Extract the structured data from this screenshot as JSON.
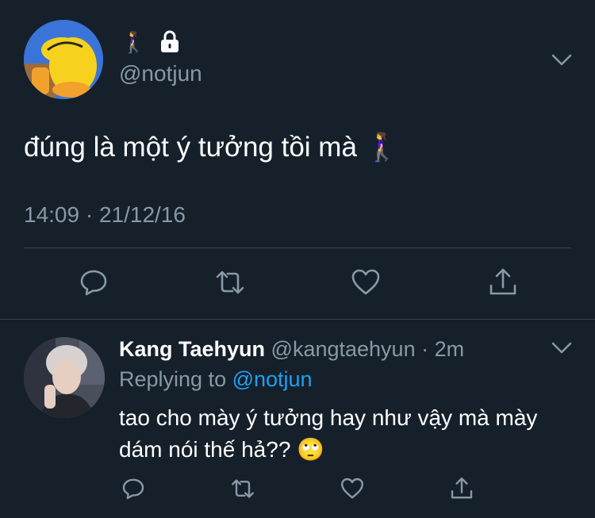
{
  "main_tweet": {
    "display_name_emoji": "🚶‍♀️",
    "handle": "@notjun",
    "text": "đúng là một ý tưởng tồi mà 🚶‍♀️",
    "timestamp": "14:09 · 21/12/16",
    "locked": true
  },
  "reply": {
    "display_name": "Kang Taehyun",
    "handle": "@kangtaehyun",
    "separator": " · ",
    "time": "2m",
    "replying_prefix": "Replying to ",
    "replying_to": "@notjun",
    "text": "tao cho mày ý tưởng hay như vậy mà mày dám nói thế hả?? 🙄"
  },
  "actions": [
    "reply-icon",
    "retweet-icon",
    "like-icon",
    "share-icon"
  ],
  "colors": {
    "background": "#15202b",
    "muted_text": "#8899a6",
    "link": "#1da1f2",
    "divider": "#38444d"
  }
}
